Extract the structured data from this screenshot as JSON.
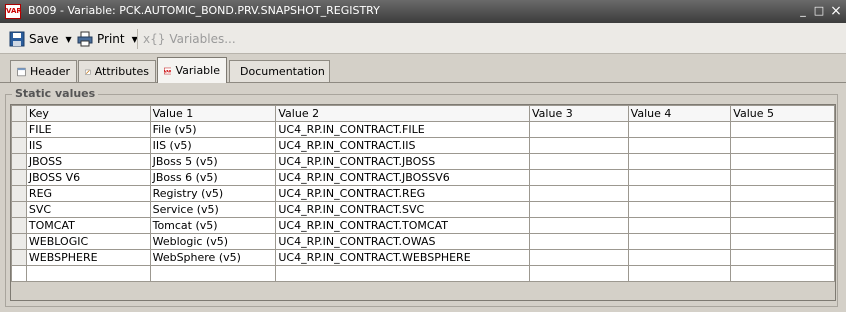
{
  "window": {
    "icon_text": "VAR",
    "title": "B009 - Variable: PCK.AUTOMIC_BOND.PRV.SNAPSHOT_REGISTRY",
    "controls": {
      "minimize": "_",
      "restore": "□",
      "close": "×"
    }
  },
  "toolbar": {
    "save_label": "Save",
    "print_label": "Print",
    "variables_label": "Variables..."
  },
  "tabs": [
    {
      "label": "Header"
    },
    {
      "label": "Attributes"
    },
    {
      "label": "Variable"
    },
    {
      "label": "Documentation"
    }
  ],
  "group": {
    "label": "Static values"
  },
  "table": {
    "columns": [
      "Key",
      "Value 1",
      "Value 2",
      "Value 3",
      "Value 4",
      "Value 5"
    ],
    "rows": [
      [
        "FILE",
        "File (v5)",
        "UC4_RP.IN_CONTRACT.FILE",
        "",
        "",
        ""
      ],
      [
        "IIS",
        "IIS (v5)",
        "UC4_RP.IN_CONTRACT.IIS",
        "",
        "",
        ""
      ],
      [
        "JBOSS",
        "JBoss 5 (v5)",
        "UC4_RP.IN_CONTRACT.JBOSS",
        "",
        "",
        ""
      ],
      [
        "JBOSS V6",
        "JBoss 6 (v5)",
        "UC4_RP.IN_CONTRACT.JBOSSV6",
        "",
        "",
        ""
      ],
      [
        "REG",
        "Registry (v5)",
        "UC4_RP.IN_CONTRACT.REG",
        "",
        "",
        ""
      ],
      [
        "SVC",
        "Service (v5)",
        "UC4_RP.IN_CONTRACT.SVC",
        "",
        "",
        ""
      ],
      [
        "TOMCAT",
        "Tomcat (v5)",
        "UC4_RP.IN_CONTRACT.TOMCAT",
        "",
        "",
        ""
      ],
      [
        "WEBLOGIC",
        "Weblogic (v5)",
        "UC4_RP.IN_CONTRACT.OWAS",
        "",
        "",
        ""
      ],
      [
        "WEBSPHERE",
        "WebSphere (v5)",
        "UC4_RP.IN_CONTRACT.WEBSPHERE",
        "",
        "",
        ""
      ],
      [
        "",
        "",
        "",
        "",
        "",
        ""
      ]
    ]
  }
}
